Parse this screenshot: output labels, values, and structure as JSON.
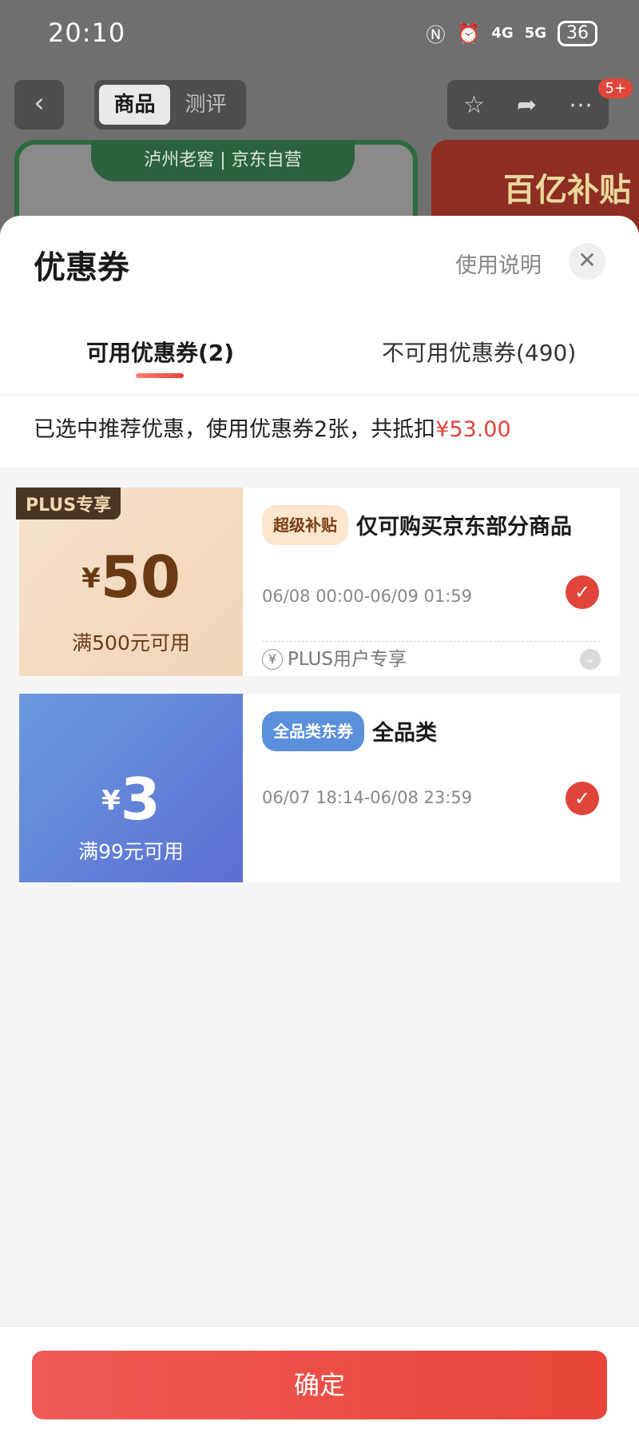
{
  "status_bar": {
    "time": "20:10",
    "signal_4g": "4G",
    "signal_5g": "5G",
    "battery": "36"
  },
  "header": {
    "back_icon": "chevron-left-icon",
    "tabs": [
      "商品",
      "测评"
    ],
    "active_tab": "商品",
    "favorite_icon": "star-icon",
    "share_icon": "share-icon",
    "more_icon": "more-icon",
    "badge": "5+"
  },
  "background_product": {
    "banner_text": "泸州老窖 | 京东自营",
    "side_text": "百亿补贴"
  },
  "sheet": {
    "title": "优惠券",
    "help_link": "使用说明",
    "close_icon": "close-icon",
    "tabs": {
      "available": "可用优惠券(2)",
      "unavailable": "不可用优惠券(490)"
    },
    "summary_prefix": "已选中推荐优惠，使用优惠券2张，共抵扣",
    "summary_amount": "¥53.00"
  },
  "coupons": [
    {
      "badge": "PLUS专享",
      "yen": "¥",
      "value": "50",
      "condition": "满500元可用",
      "tag": "超级补贴",
      "title": "仅可购买京东部分商品",
      "date": "06/08 00:00-06/09 01:59",
      "selected": true,
      "footer": "PLUS用户专享"
    },
    {
      "yen": "¥",
      "value": "3",
      "condition": "满99元可用",
      "tag": "全品类东券",
      "title": "全品类",
      "date": "06/07 18:14-06/08 23:59",
      "selected": true
    }
  ],
  "confirm_button": "确定",
  "colors": {
    "accent_red": "#e1453a",
    "plus_coupon_bg": "#f3dac0",
    "blue_coupon_bg": "#6285da"
  }
}
